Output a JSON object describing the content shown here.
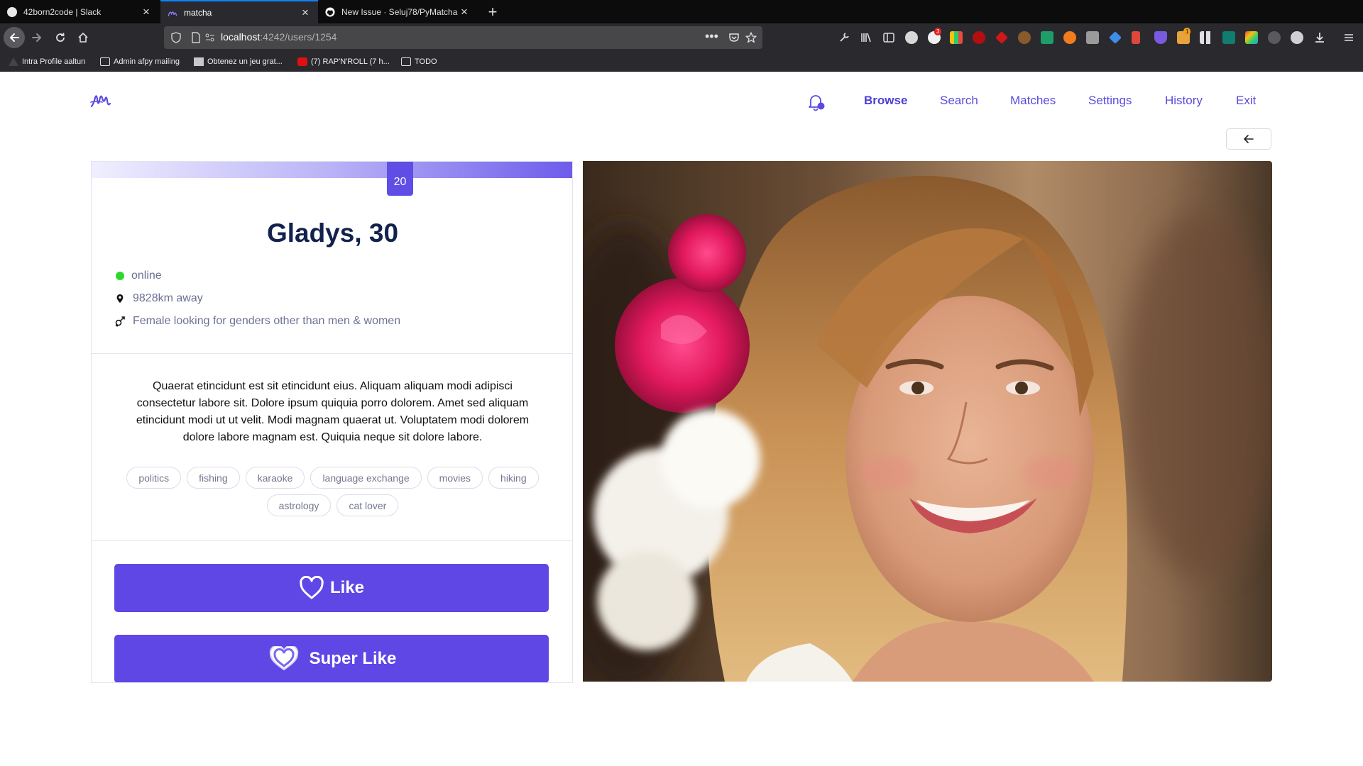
{
  "browser": {
    "tabs": [
      {
        "title": "42born2code | Slack"
      },
      {
        "title": "matcha"
      },
      {
        "title": "New Issue · Seluj78/PyMatcha"
      }
    ],
    "url_host": "localhost",
    "url_path": ":4242/users/1254",
    "bookmarks": [
      {
        "label": "Intra Profile aaltun"
      },
      {
        "label": "Admin afpy mailing"
      },
      {
        "label": "Obtenez un jeu grat..."
      },
      {
        "label": "(7) RAP'N'ROLL (7 h..."
      },
      {
        "label": "TODO"
      }
    ],
    "badges": {
      "github": "3",
      "ext": "1"
    }
  },
  "nav": {
    "browse": "Browse",
    "search": "Search",
    "matches": "Matches",
    "settings": "Settings",
    "history": "History",
    "exit": "Exit"
  },
  "profile": {
    "score": "20",
    "name": "Gladys, 30",
    "status": "online",
    "distance": "9828km away",
    "orientation": "Female looking for genders other than men & women",
    "bio": "Quaerat etincidunt est sit etincidunt eius. Aliquam aliquam modi adipisci consectetur labore sit. Dolore ipsum quiquia porro dolorem. Amet sed aliquam etincidunt modi ut ut velit. Modi magnam quaerat ut. Voluptatem modi dolorem dolore labore magnam est. Quiquia neque sit dolore labore.",
    "tags": [
      "politics",
      "fishing",
      "karaoke",
      "language exchange",
      "movies",
      "hiking",
      "astrology",
      "cat lover"
    ]
  },
  "actions": {
    "like": "Like",
    "super_like": "Super Like"
  },
  "colors": {
    "accent": "#5f47e6",
    "heading": "#13214e",
    "online": "#2ed82e"
  }
}
